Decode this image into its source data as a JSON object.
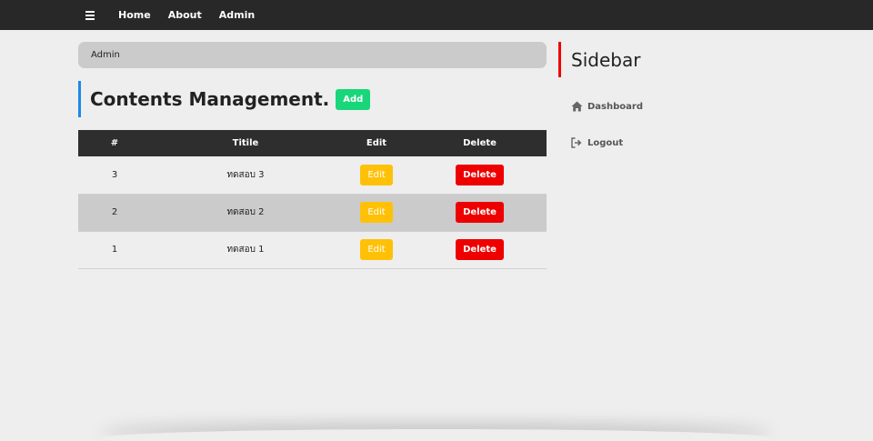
{
  "navbar": {
    "links": [
      {
        "label": "Home"
      },
      {
        "label": "About"
      },
      {
        "label": "Admin"
      }
    ]
  },
  "breadcrumb": {
    "label": "Admin"
  },
  "page": {
    "title": "Contents Management.",
    "add_label": "Add"
  },
  "table": {
    "headers": [
      "#",
      "Titile",
      "Edit",
      "Delete"
    ],
    "rows": [
      {
        "id": "3",
        "title": "ทดสอบ 3",
        "edit": "Edit",
        "delete": "Delete"
      },
      {
        "id": "2",
        "title": "ทดสอบ 2",
        "edit": "Edit",
        "delete": "Delete"
      },
      {
        "id": "1",
        "title": "ทดสอบ 1",
        "edit": "Edit",
        "delete": "Delete"
      }
    ]
  },
  "sidebar": {
    "title": "Sidebar",
    "items": [
      {
        "label": "Dashboard",
        "icon": "home-icon"
      },
      {
        "label": "Logout",
        "icon": "logout-icon"
      }
    ]
  },
  "colors": {
    "navbar": "#282828",
    "add": "#19d67a",
    "edit": "#ffc107",
    "delete": "#ee0000",
    "heading_accent": "#1e88e5",
    "sidebar_accent": "#ee0000"
  }
}
